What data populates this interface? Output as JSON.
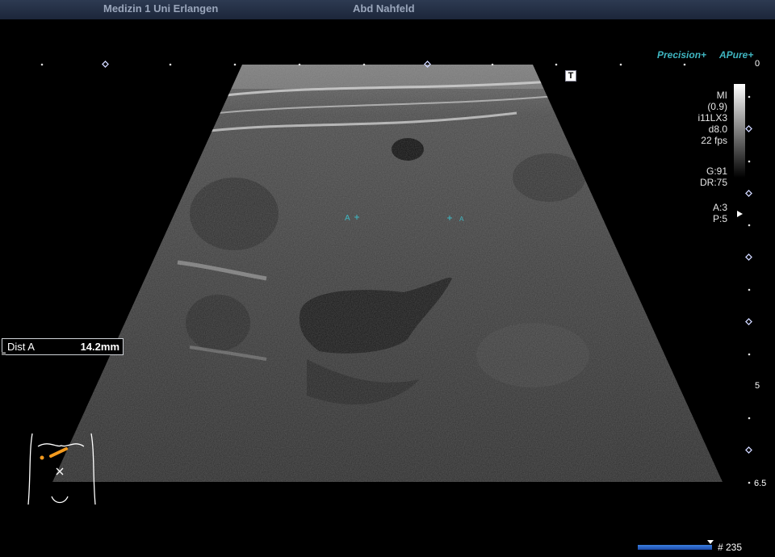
{
  "header": {
    "institution": "Medizin 1 Uni Erlangen",
    "operator": "Abd Nahfeld"
  },
  "logos": {
    "precision": "Precision+",
    "apure": "APure+"
  },
  "toolbar": {
    "t_icon": "T"
  },
  "depth_scale": {
    "top": "0",
    "mid": "5",
    "bottom": "6.5"
  },
  "parameters": {
    "mi_label": "MI",
    "mi_value": "(0.9)",
    "transducer": "i11LX3",
    "depth": "d8.0",
    "frame_rate": "22 fps",
    "gain": "G:91",
    "dynamic_range": "DR:75",
    "a_setting": "A:3",
    "p_setting": "P:5"
  },
  "measurement": {
    "label": "Dist A",
    "value": "14.2mm"
  },
  "calipers": {
    "start_label": "A",
    "end_label": "A"
  },
  "cine": {
    "frame": "# 235"
  },
  "colors": {
    "accent_teal": "#3fb6c1",
    "probe_marker": "#f39a1e",
    "cine_blue": "#2a63c7"
  }
}
